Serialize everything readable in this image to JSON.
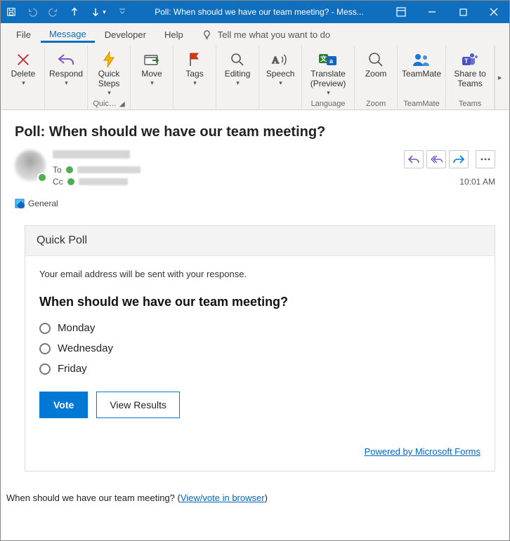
{
  "titlebar": {
    "title": "Poll: When should we have our team meeting?  -  Mess..."
  },
  "menu": {
    "file": "File",
    "message": "Message",
    "developer": "Developer",
    "help": "Help",
    "tellme": "Tell me what you want to do"
  },
  "ribbon": {
    "delete": "Delete",
    "respond": "Respond",
    "quicksteps": "Quick\nSteps",
    "quicksteps_group": "Quic…",
    "move": "Move",
    "tags": "Tags",
    "editing": "Editing",
    "speech": "Speech",
    "translate": "Translate\n(Preview)",
    "language_group": "Language",
    "zoom": "Zoom",
    "zoom_group": "Zoom",
    "teammate": "TeamMate",
    "teammate_group": "TeamMate",
    "sharetoteams": "Share to\nTeams",
    "teams_group": "Teams"
  },
  "message": {
    "subject": "Poll: When should we have our team meeting?",
    "to_label": "To",
    "cc_label": "Cc",
    "time": "10:01 AM",
    "category": "General"
  },
  "poll": {
    "header": "Quick Poll",
    "notice": "Your email address will be sent with your response.",
    "question": "When should we have our team meeting?",
    "options": [
      "Monday",
      "Wednesday",
      "Friday"
    ],
    "vote": "Vote",
    "view_results": "View Results",
    "powered": "Powered by Microsoft Forms"
  },
  "footer": {
    "text": "When should we have our team meeting? (",
    "link": "View/vote in browser",
    "text_after": ")"
  }
}
